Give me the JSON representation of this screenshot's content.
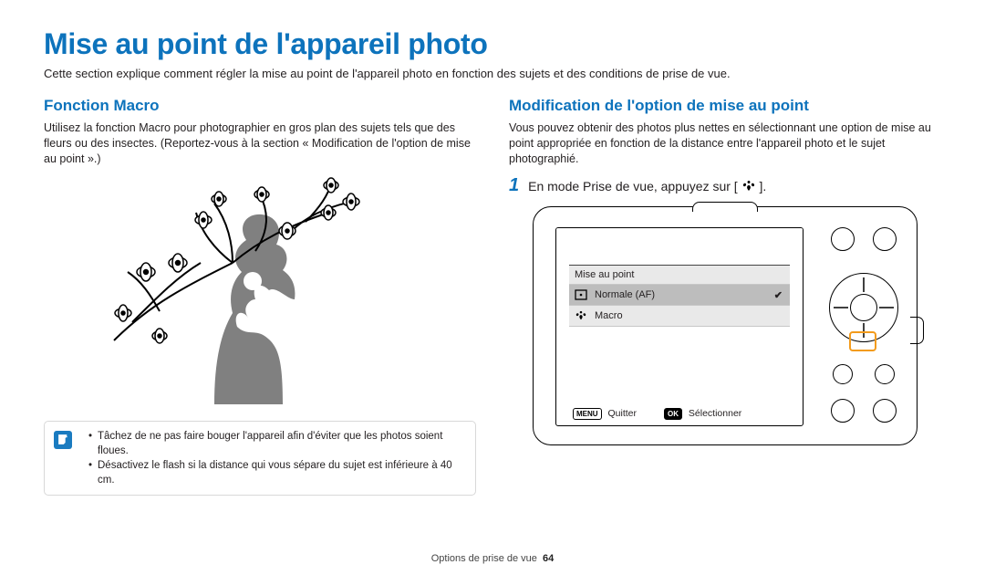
{
  "title": "Mise au point de l'appareil photo",
  "intro": "Cette section explique comment régler la mise au point de l'appareil photo en fonction des sujets et des conditions de prise de vue.",
  "left": {
    "heading": "Fonction Macro",
    "body": "Utilisez la fonction Macro pour photographier en gros plan des sujets tels que des fleurs ou des insectes. (Reportez-vous à la section « Modification de l'option de mise au point ».)",
    "notes": [
      "Tâchez de ne pas faire bouger l'appareil afin d'éviter que les photos soient floues.",
      "Désactivez le flash si la distance qui vous sépare du sujet est inférieure à 40 cm."
    ]
  },
  "right": {
    "heading": "Modification de l'option de mise au point",
    "body": "Vous pouvez obtenir des photos plus nettes en sélectionnant une option de mise au point appropriée en fonction de la distance entre l'appareil photo et le sujet photographié.",
    "step1_before": "En mode Prise de vue, appuyez sur [",
    "step1_after": "].",
    "screen": {
      "menu_title": "Mise au point",
      "option1": "Normale (AF)",
      "option2": "Macro",
      "footer_left": "Quitter",
      "footer_right": "Sélectionner",
      "key_menu": "MENU",
      "key_ok": "OK"
    }
  },
  "footer_section": "Options de prise de vue",
  "footer_page": "64"
}
